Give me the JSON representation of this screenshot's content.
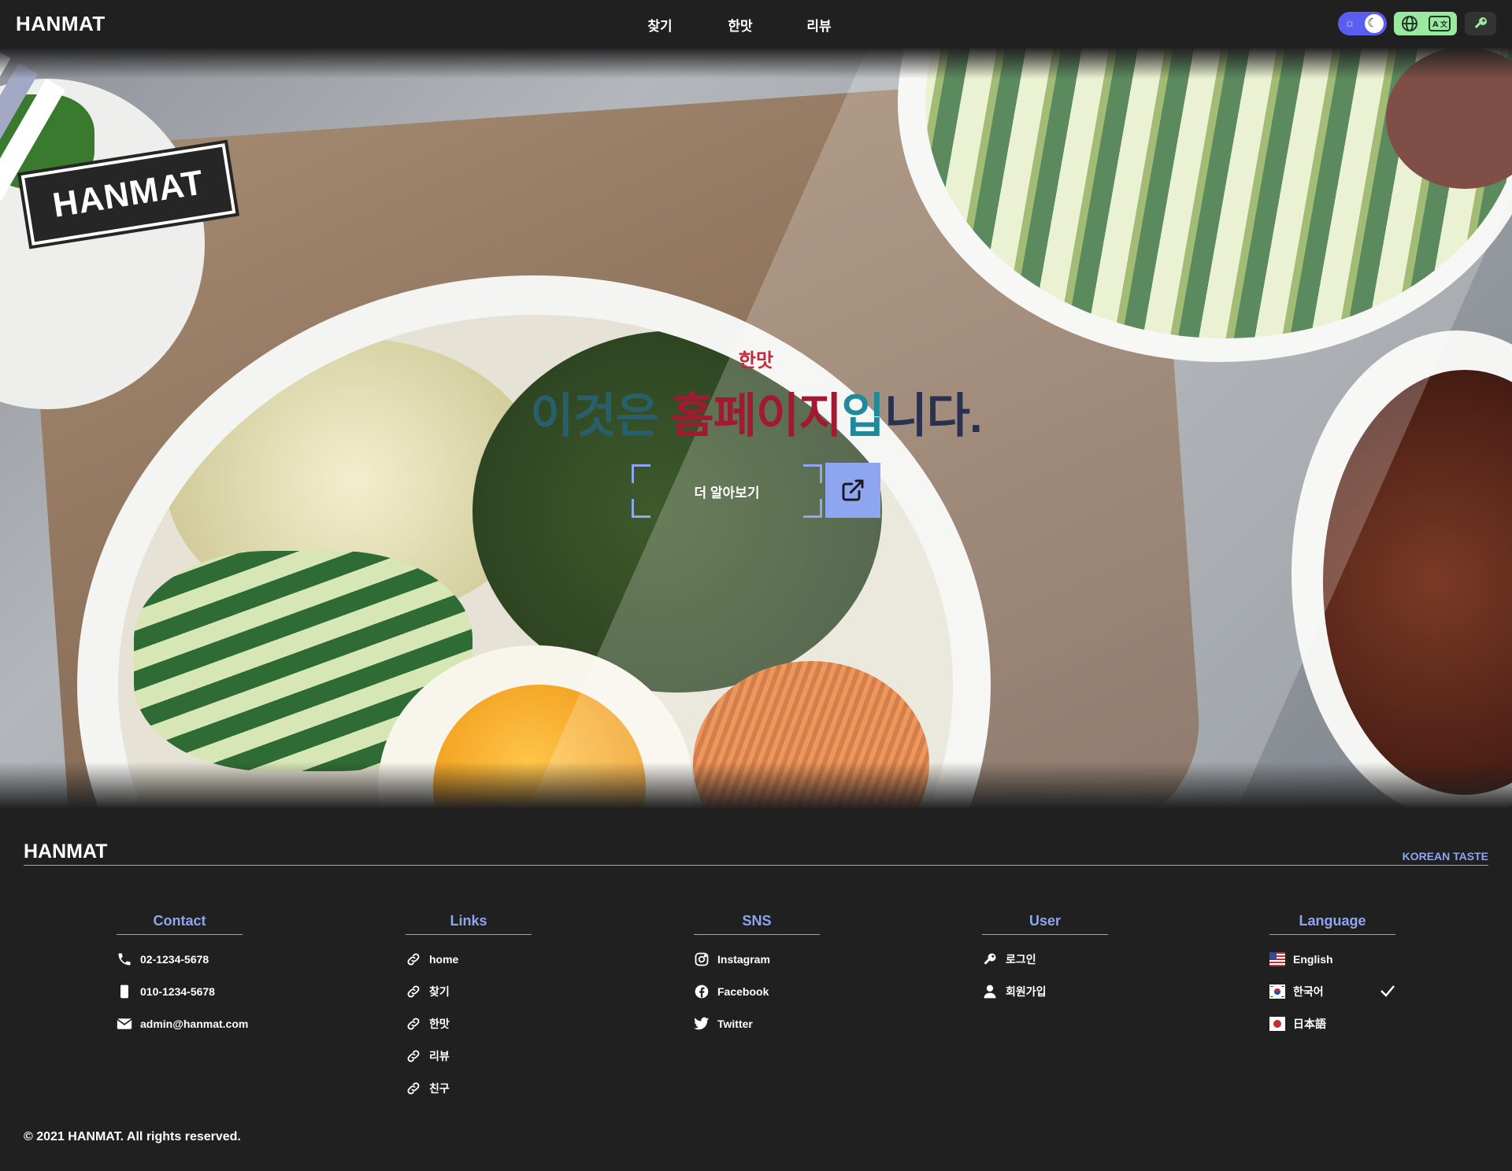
{
  "brand": "HANMAT",
  "nav": [
    "찾기",
    "한맛",
    "리뷰"
  ],
  "hero": {
    "stamp": "HANMAT",
    "subtitle": "한맛",
    "title_parts": [
      "이것은 ",
      "홈페이",
      "지",
      "입",
      "니다."
    ],
    "cta_label": "더 알아보기"
  },
  "footer": {
    "brand": "HANMAT",
    "tagline": "KOREAN TASTE",
    "contact": {
      "heading": "Contact",
      "items": [
        {
          "icon": "phone-icon",
          "label": "02-1234-5678"
        },
        {
          "icon": "mobile-icon",
          "label": "010-1234-5678"
        },
        {
          "icon": "mail-icon",
          "label": "admin@hanmat.com"
        }
      ]
    },
    "links": {
      "heading": "Links",
      "items": [
        {
          "icon": "link-icon",
          "label": "home"
        },
        {
          "icon": "link-icon",
          "label": "찾기"
        },
        {
          "icon": "link-icon",
          "label": "한맛"
        },
        {
          "icon": "link-icon",
          "label": "리뷰"
        },
        {
          "icon": "link-icon",
          "label": "친구"
        }
      ]
    },
    "sns": {
      "heading": "SNS",
      "items": [
        {
          "icon": "instagram-icon",
          "label": "Instagram"
        },
        {
          "icon": "facebook-icon",
          "label": "Facebook"
        },
        {
          "icon": "twitter-icon",
          "label": "Twitter"
        }
      ]
    },
    "user": {
      "heading": "User",
      "items": [
        {
          "icon": "key-icon",
          "label": "로그인"
        },
        {
          "icon": "user-icon",
          "label": "회원가입"
        }
      ]
    },
    "language": {
      "heading": "Language",
      "items": [
        {
          "icon": "us-flag-icon",
          "label": "English"
        },
        {
          "icon": "kr-flag-icon",
          "label": "한국어",
          "selected": true
        },
        {
          "icon": "jp-flag-icon",
          "label": "日本語"
        }
      ]
    },
    "copyright": "© 2021 HANMAT. All rights reserved."
  },
  "colors": {
    "background": "#202020",
    "accent": "#8ea6f0",
    "theme_toggle": "#5b5cf0",
    "lang_toggle": "#9be8a2",
    "title_red": "#a01a32",
    "title_teal": "#285f6a"
  }
}
